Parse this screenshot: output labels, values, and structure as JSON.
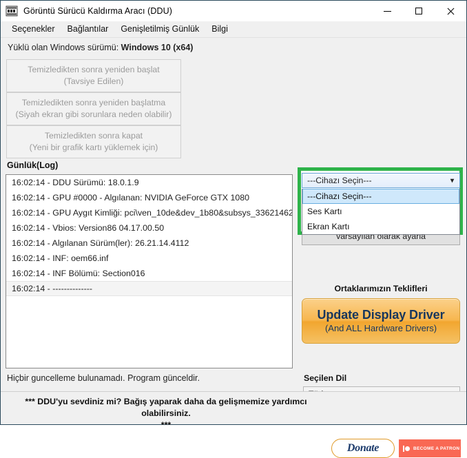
{
  "window": {
    "title": "Görüntü Sürücü Kaldırma Aracı (DDU)",
    "icon": "ddu-app-icon",
    "controls": {
      "minimize": "minimize-icon",
      "maximize": "maximize-icon",
      "close": "close-icon"
    }
  },
  "menubar": {
    "items": [
      {
        "label": "Seçenekler"
      },
      {
        "label": "Bağlantılar"
      },
      {
        "label": "Genişletilmiş Günlük"
      },
      {
        "label": "Bilgi"
      }
    ]
  },
  "os_info": {
    "prefix": "Yüklü olan Windows sürümü: ",
    "value": "Windows 10 (x64)"
  },
  "actions": {
    "restart": {
      "line1": "Temizledikten sonra yeniden başlat",
      "line2": "(Tavsiye Edilen)"
    },
    "no_restart": {
      "line1": "Temizledikten sonra yeniden başlatma",
      "line2": "(Siyah ekran gibi sorunlara neden olabilir)"
    },
    "shutdown": {
      "line1": "Temizledikten sonra kapat",
      "line2": "(Yeni bir grafik kartı yüklemek için)"
    }
  },
  "log": {
    "label": "Günlük(Log)",
    "lines": [
      "16:02:14 - DDU Sürümü: 18.0.1.9",
      "16:02:14 - GPU #0000 - Algılanan: NVIDIA GeForce GTX 1080",
      "16:02:14 - GPU Aygıt Kimliği: pci\\ven_10de&dev_1b80&subsys_33621462",
      "16:02:14 - Vbios: Version86 04.17.00.50",
      "16:02:14 - Algılanan Sürüm(ler): 26.21.14.4112",
      "16:02:14 - INF: oem66.inf",
      "16:02:14 - INF Bölümü: Section016",
      "16:02:14 - --------------"
    ],
    "selected_index": 7
  },
  "status": {
    "text": "Hiçbir guncelleme bulunamadı. Program günceldir."
  },
  "device_select": {
    "highlight_color": "#2eb34a",
    "selected": "---Cihazı Seçin---",
    "arrow": "chevron-down-icon",
    "open": true,
    "options": [
      {
        "label": "---Cihazı Seçin---",
        "highlighted": true
      },
      {
        "label": "Ses Kartı",
        "highlighted": false
      },
      {
        "label": "Ekran Kartı",
        "highlighted": false
      }
    ]
  },
  "set_default_button": {
    "label": "varsayılan olarak ayarla"
  },
  "partners": {
    "label": "Ortaklarımızın Teklifleri",
    "banner": {
      "title": "Update Display Driver",
      "subtitle": "(And ALL Hardware Drivers)",
      "accent": "#f2a62f",
      "text_color": "#17365d"
    }
  },
  "language": {
    "label": "Seçilen Dil",
    "selected": "Türkçe",
    "arrow": "chevron-down-icon"
  },
  "donation": {
    "message_line1": "*** DDU'yu sevdiniz mi? Bağış yaparak daha da gelişmemize yardımcı olabilirsiniz.",
    "message_line2": "***",
    "donate_label": "Donate",
    "patron_label": "BECOME A PATRON",
    "patron_color": "#f96854"
  }
}
